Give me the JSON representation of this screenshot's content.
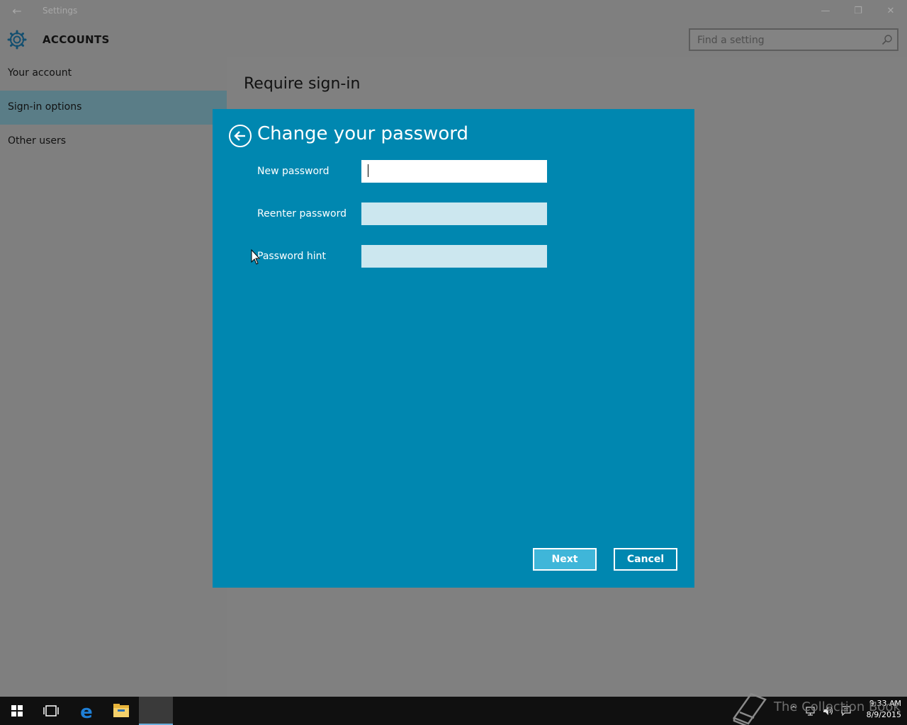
{
  "window": {
    "title": "Settings",
    "back_glyph": "←",
    "minimize_glyph": "—",
    "restore_glyph": "❐",
    "close_glyph": "✕"
  },
  "header": {
    "title": "ACCOUNTS",
    "icon": "gear-icon",
    "search_placeholder": "Find a setting"
  },
  "sidebar": {
    "items": [
      {
        "label": "Your account",
        "active": false
      },
      {
        "label": "Sign-in options",
        "active": true
      },
      {
        "label": "Other users",
        "active": false
      }
    ]
  },
  "content": {
    "title": "Require sign-in"
  },
  "dialog": {
    "title": "Change your password",
    "fields": [
      {
        "label": "New password",
        "value": "",
        "focused": true
      },
      {
        "label": "Reenter password",
        "value": "",
        "focused": false
      },
      {
        "label": "Password hint",
        "value": "",
        "focused": false
      }
    ],
    "next_label": "Next",
    "cancel_label": "Cancel"
  },
  "taskbar": {
    "time": "9:33 AM",
    "date": "8/9/2015",
    "watermark": "The Collection Book"
  },
  "colors": {
    "dialog_bg": "#0087b0",
    "next_button": "#3fb6d9",
    "accent_text": "#1a6fa8"
  }
}
